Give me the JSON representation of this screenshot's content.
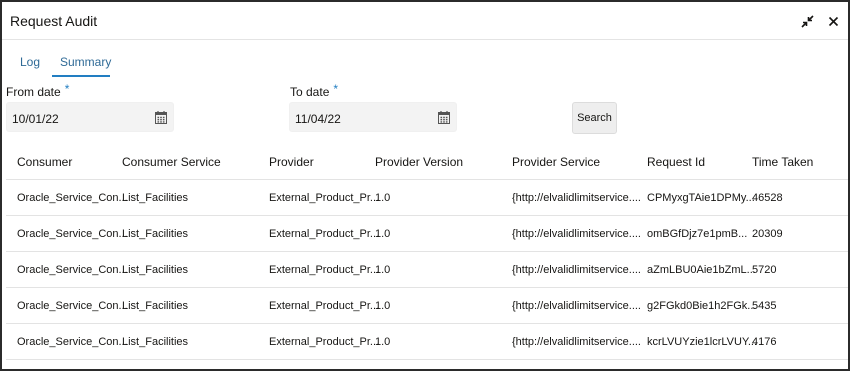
{
  "dialog": {
    "title": "Request Audit",
    "icons": {
      "minimize": "collapse-arrows-icon",
      "close": "close-icon"
    },
    "close_glyph": "x"
  },
  "tabs": [
    {
      "label": "Log",
      "selected": false
    },
    {
      "label": "Summary",
      "selected": true
    }
  ],
  "form": {
    "from_date": {
      "label": "From date",
      "required_mark": "*",
      "value": "10/01/22",
      "icon": "calendar-icon"
    },
    "to_date": {
      "label": "To date",
      "required_mark": "*",
      "value": "11/04/22",
      "icon": "calendar-icon"
    },
    "search_label": "Search"
  },
  "table": {
    "columns": [
      "Consumer",
      "Consumer Service",
      "Provider",
      "Provider Version",
      "Provider Service",
      "Request Id",
      "Time Taken"
    ],
    "rows": [
      [
        "Oracle_Service_Con...",
        "List_Facilities",
        "External_Product_Pr...",
        "1.0",
        "{http://elvalidlimitservice....",
        "CPMyxgTAie1DPMy...",
        "46528"
      ],
      [
        "Oracle_Service_Con...",
        "List_Facilities",
        "External_Product_Pr...",
        "1.0",
        "{http://elvalidlimitservice....",
        "omBGfDjz7e1pmB...",
        "20309"
      ],
      [
        "Oracle_Service_Con...",
        "List_Facilities",
        "External_Product_Pr...",
        "1.0",
        "{http://elvalidlimitservice....",
        "aZmLBU0Aie1bZmL...",
        "5720"
      ],
      [
        "Oracle_Service_Con...",
        "List_Facilities",
        "External_Product_Pr...",
        "1.0",
        "{http://elvalidlimitservice....",
        "g2FGkd0Bie1h2FGk...",
        "5435"
      ],
      [
        "Oracle_Service_Con...",
        "List_Facilities",
        "External_Product_Pr...",
        "1.0",
        "{http://elvalidlimitservice....",
        "kcrLVUYzie1lcrLVUY...",
        "4176"
      ]
    ]
  },
  "colors": {
    "accent": "#227ec2",
    "tab_text": "#2f6a96",
    "input_bg": "#f3f3f3"
  }
}
